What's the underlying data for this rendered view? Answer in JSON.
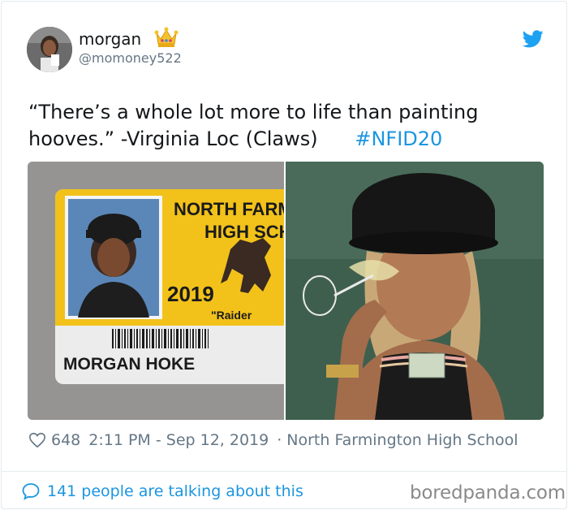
{
  "user": {
    "display_name": "morgan",
    "handle": "@momoney522",
    "avatar_icon": "avatar-photo",
    "badge_icon": "crown-emoji"
  },
  "tweet": {
    "text": "“There’s a whole lot more to life than painting\nhooves.” -Virginia Loc (Claws)      ",
    "hashtag": "#NFID20"
  },
  "media": {
    "id_card": {
      "school_line1": "NORTH FARMI",
      "school_line2": "HIGH SCH",
      "year": "2019",
      "mascot": "\"Raider",
      "name": "MORGAN HOKE"
    }
  },
  "meta": {
    "likes": "648",
    "timestamp": "2:11 PM - Sep 12, 2019",
    "separator": "·",
    "location": "North Farmington High School"
  },
  "footer": {
    "talking": "141 people are talking about this",
    "watermark": "boredpanda.com"
  },
  "colors": {
    "link": "#1b95e0",
    "muted": "#657786",
    "twitter_blue": "#1da1f2",
    "id_yellow": "#f2c21b"
  }
}
